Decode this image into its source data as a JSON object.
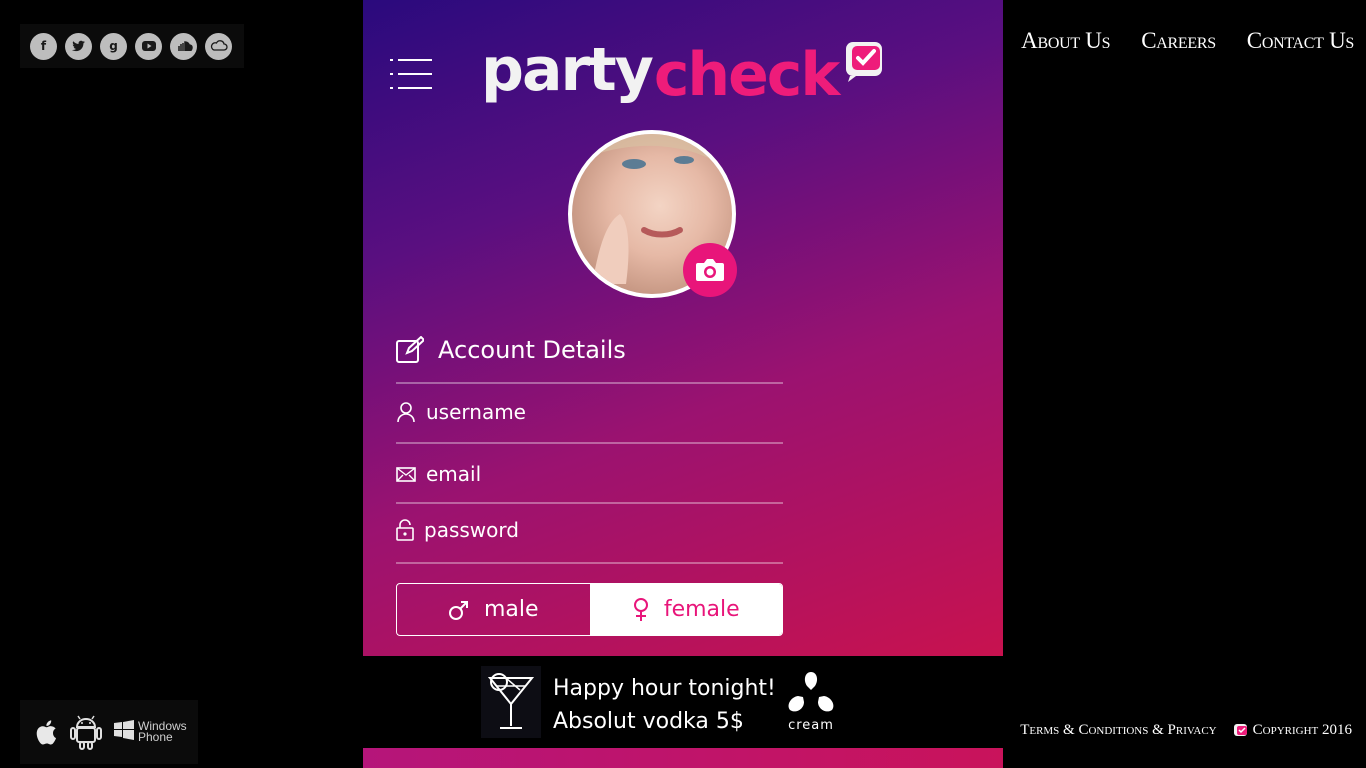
{
  "social_icons": [
    "facebook-icon",
    "twitter-icon",
    "google-plus-icon",
    "youtube-icon",
    "soundcloud-icon",
    "cloud-radio-icon"
  ],
  "stores": {
    "windows_phone_label": "Windows Phone",
    "windows_line1": "Windows",
    "windows_line2": "Phone"
  },
  "nav": {
    "about": "About Us",
    "careers": "Careers",
    "contact": "Contact Us"
  },
  "logo": {
    "part1": "party",
    "part2": "check"
  },
  "form": {
    "section_title": "Account Details",
    "username_placeholder": "username",
    "email_placeholder": "email",
    "password_placeholder": "password",
    "male_label": "male",
    "female_label": "female",
    "selected_gender": "female"
  },
  "ad": {
    "line1": "Happy hour tonight!",
    "line2": "Absolut vodka 5$",
    "brand": "cream"
  },
  "footer": {
    "terms": "Terms & Conditions & Privacy",
    "copyright": "Copyright 2016"
  },
  "colors": {
    "accent": "#e8157a",
    "gradient_top": "#2a0a7d",
    "gradient_bottom": "#c8124f"
  }
}
